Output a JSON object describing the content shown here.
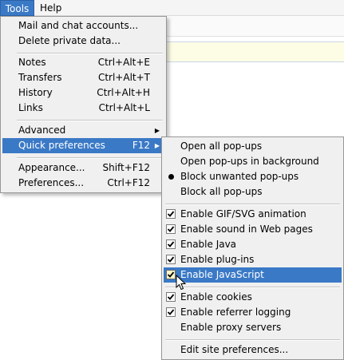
{
  "menubar": {
    "tools": "Tools",
    "help": "Help"
  },
  "tools_menu": {
    "items": [
      {
        "label": "Mail and chat accounts...",
        "shortcut": ""
      },
      {
        "label": "Delete private data...",
        "shortcut": ""
      },
      {
        "label": "Notes",
        "shortcut": "Ctrl+Alt+E"
      },
      {
        "label": "Transfers",
        "shortcut": "Ctrl+Alt+T"
      },
      {
        "label": "History",
        "shortcut": "Ctrl+Alt+H"
      },
      {
        "label": "Links",
        "shortcut": "Ctrl+Alt+L"
      },
      {
        "label": "Advanced",
        "shortcut": ""
      },
      {
        "label": "Quick preferences",
        "shortcut": "F12"
      },
      {
        "label": "Appearance...",
        "shortcut": "Shift+F12"
      },
      {
        "label": "Preferences...",
        "shortcut": "Ctrl+F12"
      }
    ],
    "submenu_arrow": "▶"
  },
  "quick_preferences": {
    "popups": [
      {
        "label": "Open all pop-ups",
        "selected": false
      },
      {
        "label": "Open pop-ups in background",
        "selected": false
      },
      {
        "label": "Block unwanted pop-ups",
        "selected": true
      },
      {
        "label": "Block all pop-ups",
        "selected": false
      }
    ],
    "features": [
      {
        "label": "Enable GIF/SVG animation",
        "checked": true
      },
      {
        "label": "Enable sound in Web pages",
        "checked": true
      },
      {
        "label": "Enable Java",
        "checked": true
      },
      {
        "label": "Enable plug-ins",
        "checked": true
      },
      {
        "label": "Enable JavaScript",
        "checked": true
      }
    ],
    "privacy": [
      {
        "label": "Enable cookies",
        "checked": true
      },
      {
        "label": "Enable referrer logging",
        "checked": true
      },
      {
        "label": "Enable proxy servers",
        "checked": false
      }
    ],
    "site_prefs": "Edit site preferences..."
  },
  "colors": {
    "highlight": "#3a79c6",
    "menu_bg": "#f0f0f0"
  }
}
